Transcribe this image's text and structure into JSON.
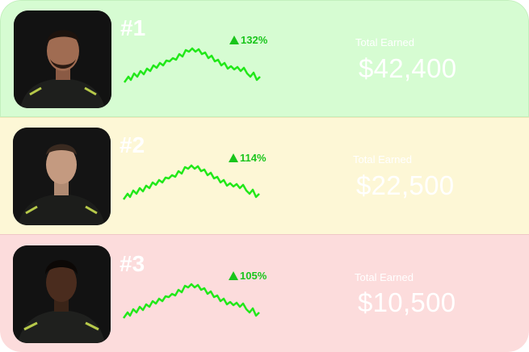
{
  "leaderboard": {
    "rows": [
      {
        "rank": "#1",
        "change": "132%",
        "label": "Total Earned",
        "amount": "$42,400",
        "background": "#d6fcd2"
      },
      {
        "rank": "#2",
        "change": "114%",
        "label": "Total Earned",
        "amount": "$22,500",
        "background": "#fdf7d6"
      },
      {
        "rank": "#3",
        "change": "105%",
        "label": "Total Earned",
        "amount": "$10,500",
        "background": "#fcdcdc"
      }
    ]
  },
  "colors": {
    "trend_green": "#19c51b",
    "sparkline": "#22e81a",
    "text_white": "#ffffff"
  },
  "icons": {
    "trend": "up-triangle-icon"
  }
}
